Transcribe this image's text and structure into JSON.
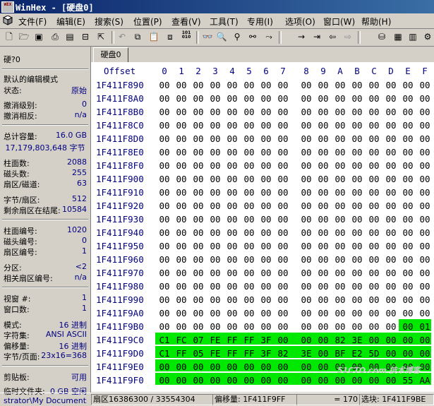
{
  "window": {
    "title": "WinHex - [硬盘0]",
    "icon_text": "WEX"
  },
  "menu": [
    "文件(F)",
    "编辑(E)",
    "搜索(S)",
    "位置(P)",
    "查看(V)",
    "工具(T)",
    "专用(I)",
    "选项(O)",
    "窗口(W)",
    "帮助(H)"
  ],
  "tab": {
    "label": "硬盘0"
  },
  "panel": {
    "device": "硬?0",
    "edit_mode": "默认的编辑模式",
    "state": {
      "label": "状态:",
      "value": "原始"
    },
    "undo_level": {
      "label": "撤消级别:",
      "value": "0"
    },
    "undo_reverse": {
      "label": "撤消相反:",
      "value": "n/a"
    },
    "total_capacity": {
      "label": "总计容量:",
      "value": "16.0 GB"
    },
    "total_bytes": "17,179,803,648 字节",
    "cylinders": {
      "label": "柱面数:",
      "value": "2088"
    },
    "heads": {
      "label": "磁头数:",
      "value": "255"
    },
    "sectors_per_track": {
      "label": "扇区/磁道:",
      "value": "63"
    },
    "bytes_per_sector": {
      "label": "字节/扇区:",
      "value": "512"
    },
    "remaining_sectors": {
      "label": "剩余扇区在结尾:",
      "value": "10584"
    },
    "cylinder_no": {
      "label": "柱面编号:",
      "value": "1020"
    },
    "head_no": {
      "label": "磁头编号:",
      "value": "0"
    },
    "sector_no": {
      "label": "扇区编号:",
      "value": "1"
    },
    "partition": {
      "label": "分区:",
      "value": "<2"
    },
    "relative_sector": {
      "label": "相关扇区编号:",
      "value": "n/a"
    },
    "window_no": {
      "label": "视窗 #:",
      "value": "1"
    },
    "window_count": {
      "label": "窗口数:",
      "value": "1"
    },
    "mode": {
      "label": "模式:",
      "value": "16 进制"
    },
    "charset": {
      "label": "字符集:",
      "value": "ANSI ASCII"
    },
    "offset_mode": {
      "label": "偏移量:",
      "value": "16 进制"
    },
    "bytes_per_page": {
      "label": "字节/页面:",
      "value": "23x16=368"
    },
    "clipboard": {
      "label": "剪贴板:",
      "value": "可用"
    },
    "temp_folder": {
      "label": "临时文件夹:",
      "value": "0 GB 空闲"
    },
    "temp_path": "strator\\My Documents"
  },
  "hex": {
    "offset_label": "Offset",
    "columns": [
      "0",
      "1",
      "2",
      "3",
      "4",
      "5",
      "6",
      "7",
      "8",
      "9",
      "A",
      "B",
      "C",
      "D",
      "E",
      "F"
    ],
    "rows": [
      {
        "addr": "1F411F890",
        "bytes": [
          "00",
          "00",
          "00",
          "00",
          "00",
          "00",
          "00",
          "00",
          "00",
          "00",
          "00",
          "00",
          "00",
          "00",
          "00",
          "00"
        ]
      },
      {
        "addr": "1F411F8A0",
        "bytes": [
          "00",
          "00",
          "00",
          "00",
          "00",
          "00",
          "00",
          "00",
          "00",
          "00",
          "00",
          "00",
          "00",
          "00",
          "00",
          "00"
        ]
      },
      {
        "addr": "1F411F8B0",
        "bytes": [
          "00",
          "00",
          "00",
          "00",
          "00",
          "00",
          "00",
          "00",
          "00",
          "00",
          "00",
          "00",
          "00",
          "00",
          "00",
          "00"
        ]
      },
      {
        "addr": "1F411F8C0",
        "bytes": [
          "00",
          "00",
          "00",
          "00",
          "00",
          "00",
          "00",
          "00",
          "00",
          "00",
          "00",
          "00",
          "00",
          "00",
          "00",
          "00"
        ]
      },
      {
        "addr": "1F411F8D0",
        "bytes": [
          "00",
          "00",
          "00",
          "00",
          "00",
          "00",
          "00",
          "00",
          "00",
          "00",
          "00",
          "00",
          "00",
          "00",
          "00",
          "00"
        ]
      },
      {
        "addr": "1F411F8E0",
        "bytes": [
          "00",
          "00",
          "00",
          "00",
          "00",
          "00",
          "00",
          "00",
          "00",
          "00",
          "00",
          "00",
          "00",
          "00",
          "00",
          "00"
        ]
      },
      {
        "addr": "1F411F8F0",
        "bytes": [
          "00",
          "00",
          "00",
          "00",
          "00",
          "00",
          "00",
          "00",
          "00",
          "00",
          "00",
          "00",
          "00",
          "00",
          "00",
          "00"
        ]
      },
      {
        "addr": "1F411F900",
        "bytes": [
          "00",
          "00",
          "00",
          "00",
          "00",
          "00",
          "00",
          "00",
          "00",
          "00",
          "00",
          "00",
          "00",
          "00",
          "00",
          "00"
        ]
      },
      {
        "addr": "1F411F910",
        "bytes": [
          "00",
          "00",
          "00",
          "00",
          "00",
          "00",
          "00",
          "00",
          "00",
          "00",
          "00",
          "00",
          "00",
          "00",
          "00",
          "00"
        ]
      },
      {
        "addr": "1F411F920",
        "bytes": [
          "00",
          "00",
          "00",
          "00",
          "00",
          "00",
          "00",
          "00",
          "00",
          "00",
          "00",
          "00",
          "00",
          "00",
          "00",
          "00"
        ]
      },
      {
        "addr": "1F411F930",
        "bytes": [
          "00",
          "00",
          "00",
          "00",
          "00",
          "00",
          "00",
          "00",
          "00",
          "00",
          "00",
          "00",
          "00",
          "00",
          "00",
          "00"
        ]
      },
      {
        "addr": "1F411F940",
        "bytes": [
          "00",
          "00",
          "00",
          "00",
          "00",
          "00",
          "00",
          "00",
          "00",
          "00",
          "00",
          "00",
          "00",
          "00",
          "00",
          "00"
        ]
      },
      {
        "addr": "1F411F950",
        "bytes": [
          "00",
          "00",
          "00",
          "00",
          "00",
          "00",
          "00",
          "00",
          "00",
          "00",
          "00",
          "00",
          "00",
          "00",
          "00",
          "00"
        ]
      },
      {
        "addr": "1F411F960",
        "bytes": [
          "00",
          "00",
          "00",
          "00",
          "00",
          "00",
          "00",
          "00",
          "00",
          "00",
          "00",
          "00",
          "00",
          "00",
          "00",
          "00"
        ]
      },
      {
        "addr": "1F411F970",
        "bytes": [
          "00",
          "00",
          "00",
          "00",
          "00",
          "00",
          "00",
          "00",
          "00",
          "00",
          "00",
          "00",
          "00",
          "00",
          "00",
          "00"
        ]
      },
      {
        "addr": "1F411F980",
        "bytes": [
          "00",
          "00",
          "00",
          "00",
          "00",
          "00",
          "00",
          "00",
          "00",
          "00",
          "00",
          "00",
          "00",
          "00",
          "00",
          "00"
        ]
      },
      {
        "addr": "1F411F990",
        "bytes": [
          "00",
          "00",
          "00",
          "00",
          "00",
          "00",
          "00",
          "00",
          "00",
          "00",
          "00",
          "00",
          "00",
          "00",
          "00",
          "00"
        ]
      },
      {
        "addr": "1F411F9A0",
        "bytes": [
          "00",
          "00",
          "00",
          "00",
          "00",
          "00",
          "00",
          "00",
          "00",
          "00",
          "00",
          "00",
          "00",
          "00",
          "00",
          "00"
        ]
      },
      {
        "addr": "1F411F9B0",
        "bytes": [
          "00",
          "00",
          "00",
          "00",
          "00",
          "00",
          "00",
          "00",
          "00",
          "00",
          "00",
          "00",
          "00",
          "00",
          "00",
          "01"
        ],
        "hl_from": 14
      },
      {
        "addr": "1F411F9C0",
        "bytes": [
          "C1",
          "FC",
          "07",
          "FE",
          "FF",
          "FF",
          "3F",
          "00",
          "00",
          "00",
          "82",
          "3E",
          "00",
          "00",
          "00",
          "00"
        ],
        "hl_from": 0
      },
      {
        "addr": "1F411F9D0",
        "bytes": [
          "C1",
          "FF",
          "05",
          "FE",
          "FF",
          "FF",
          "3F",
          "82",
          "3E",
          "00",
          "BF",
          "E2",
          "5D",
          "00",
          "00",
          "00"
        ],
        "hl_from": 0
      },
      {
        "addr": "1F411F9E0",
        "bytes": [
          "00",
          "00",
          "00",
          "00",
          "00",
          "00",
          "00",
          "00",
          "00",
          "00",
          "00",
          "00",
          "00",
          "00",
          "00",
          "00"
        ],
        "hl_from": 0
      },
      {
        "addr": "1F411F9F0",
        "bytes": [
          "00",
          "00",
          "00",
          "00",
          "00",
          "00",
          "00",
          "00",
          "00",
          "00",
          "00",
          "00",
          "00",
          "00",
          "55",
          "AA"
        ],
        "hl_from": 0
      }
    ]
  },
  "status": {
    "sector": "扇区16386300 / 33554304",
    "offset": "偏移量: 1F411F9FF",
    "value": "= 170",
    "selection": "选块: 1F411F9BE"
  },
  "watermark": "51CTO.com 技术博客",
  "colors": {
    "highlight": "#00e800",
    "offset_text": "#000080",
    "panel_value": "#000080"
  }
}
